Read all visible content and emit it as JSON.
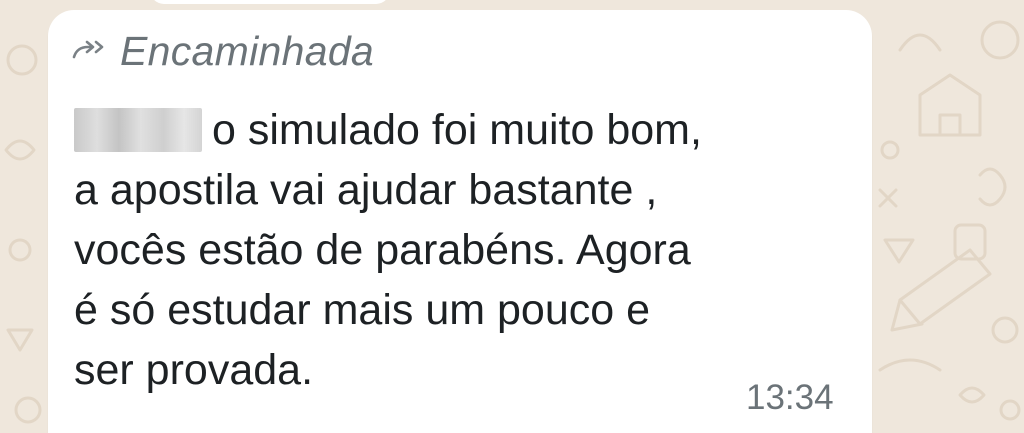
{
  "message": {
    "forwarded_label": "Encaminhada",
    "lines": [
      "o simulado foi muito bom,",
      "a apostila vai ajudar bastante ,",
      "vocês estão de parabéns. Agora",
      "é só estudar mais um pouco e",
      "ser provada."
    ],
    "time": "13:34"
  },
  "icons": {
    "forwarded": "forward-arrows-icon",
    "redaction": "redacted-name"
  },
  "colors": {
    "wallpaper": "#efe7dc",
    "bubble": "#ffffff",
    "text": "#1d2124",
    "meta": "#6b7378"
  }
}
